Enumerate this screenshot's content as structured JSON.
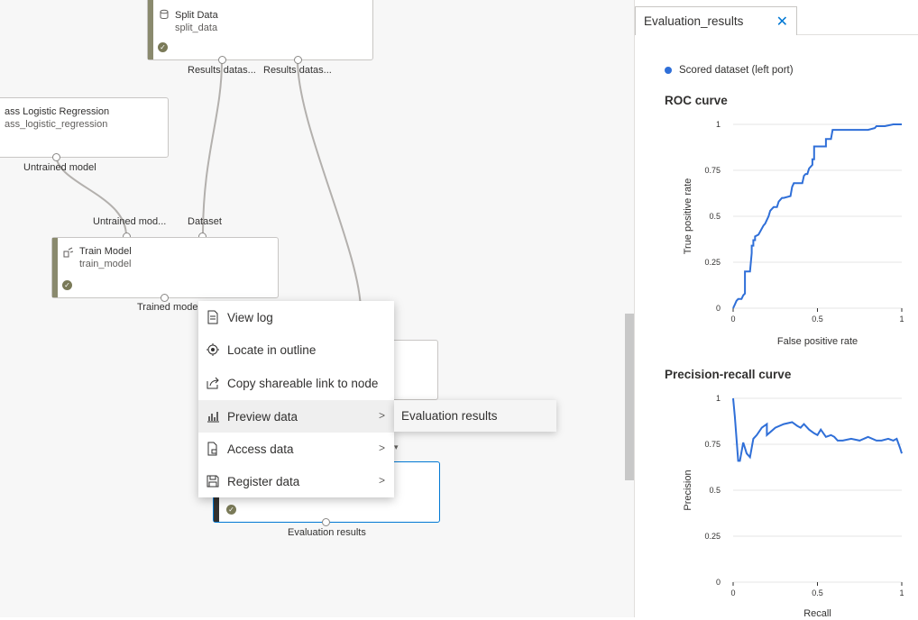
{
  "canvas": {
    "split_node": {
      "title": "Split Data",
      "subtitle": "split_data",
      "port1": "Results datas...",
      "port2": "Results datas..."
    },
    "logreg_node": {
      "title": "ass Logistic Regression",
      "subtitle": "ass_logistic_regression",
      "port": "Untrained model"
    },
    "train_node": {
      "title": "Train Model",
      "subtitle": "train_model",
      "in1": "Untrained mod...",
      "in2": "Dataset",
      "out": "Trained model"
    },
    "eval_node": {
      "out": "Evaluation results"
    }
  },
  "context_menu": {
    "items": [
      {
        "label": "View log",
        "icon": "document-icon"
      },
      {
        "label": "Locate in outline",
        "icon": "locate-icon"
      },
      {
        "label": "Copy shareable link to node",
        "icon": "share-icon"
      },
      {
        "label": "Preview data",
        "icon": "chart-icon",
        "has_submenu": true
      },
      {
        "label": "Access data",
        "icon": "file-lock-icon",
        "has_submenu": true
      },
      {
        "label": "Register data",
        "icon": "save-icon",
        "has_submenu": true
      }
    ],
    "submenu": {
      "label": "Evaluation results"
    }
  },
  "panel": {
    "tab_title": "Evaluation_results",
    "legend": "Scored dataset (left port)",
    "roc_title": "ROC curve",
    "pr_title": "Precision-recall curve"
  },
  "colors": {
    "series": "#2f6fd8",
    "accent": "#0078d4",
    "node_stripe": "#8a8a6e"
  },
  "chart_data": [
    {
      "type": "line",
      "title": "ROC curve",
      "xlabel": "False positive rate",
      "ylabel": "True positive rate",
      "xlim": [
        0,
        1
      ],
      "ylim": [
        0,
        1
      ],
      "xticks": [
        "0",
        "0.5",
        "1"
      ],
      "yticks": [
        "0",
        "0.25",
        "0.5",
        "0.75",
        "1"
      ],
      "grid": true,
      "series": [
        {
          "name": "Scored dataset (left port)",
          "x": [
            0,
            0.01,
            0.02,
            0.03,
            0.05,
            0.06,
            0.07,
            0.07,
            0.1,
            0.11,
            0.11,
            0.12,
            0.12,
            0.13,
            0.13,
            0.15,
            0.15,
            0.18,
            0.19,
            0.2,
            0.21,
            0.22,
            0.23,
            0.24,
            0.26,
            0.27,
            0.28,
            0.29,
            0.3,
            0.34,
            0.35,
            0.36,
            0.37,
            0.41,
            0.42,
            0.43,
            0.44,
            0.45,
            0.47,
            0.47,
            0.48,
            0.48,
            0.55,
            0.55,
            0.58,
            0.59,
            0.61,
            0.65,
            0.7,
            0.75,
            0.8,
            0.84,
            0.85,
            0.9,
            0.95,
            1.0
          ],
          "y": [
            0,
            0.02,
            0.04,
            0.05,
            0.05,
            0.07,
            0.08,
            0.2,
            0.2,
            0.3,
            0.34,
            0.34,
            0.37,
            0.37,
            0.39,
            0.4,
            0.4,
            0.45,
            0.46,
            0.48,
            0.5,
            0.53,
            0.54,
            0.55,
            0.55,
            0.58,
            0.59,
            0.6,
            0.6,
            0.61,
            0.66,
            0.68,
            0.68,
            0.68,
            0.72,
            0.73,
            0.73,
            0.76,
            0.78,
            0.81,
            0.81,
            0.88,
            0.88,
            0.92,
            0.92,
            0.97,
            0.97,
            0.97,
            0.97,
            0.97,
            0.97,
            0.98,
            0.99,
            0.99,
            1.0,
            1.0
          ]
        }
      ]
    },
    {
      "type": "line",
      "title": "Precision-recall curve",
      "xlabel": "Recall",
      "ylabel": "Precision",
      "xlim": [
        0,
        1
      ],
      "ylim": [
        0,
        1
      ],
      "xticks": [
        "0",
        "0.5",
        "1"
      ],
      "yticks": [
        "0",
        "0.25",
        "0.5",
        "0.75",
        "1"
      ],
      "grid": true,
      "series": [
        {
          "name": "Scored dataset (left port)",
          "x": [
            0,
            0.01,
            0.03,
            0.04,
            0.06,
            0.08,
            0.1,
            0.12,
            0.14,
            0.17,
            0.2,
            0.2,
            0.25,
            0.3,
            0.35,
            0.38,
            0.4,
            0.42,
            0.45,
            0.48,
            0.5,
            0.52,
            0.55,
            0.58,
            0.6,
            0.62,
            0.65,
            0.7,
            0.75,
            0.8,
            0.85,
            0.88,
            0.92,
            0.95,
            0.97,
            0.99,
            1.0
          ],
          "y": [
            1.0,
            0.9,
            0.66,
            0.66,
            0.76,
            0.7,
            0.68,
            0.78,
            0.8,
            0.84,
            0.86,
            0.8,
            0.84,
            0.86,
            0.87,
            0.85,
            0.84,
            0.86,
            0.83,
            0.81,
            0.8,
            0.83,
            0.79,
            0.8,
            0.79,
            0.77,
            0.77,
            0.78,
            0.77,
            0.79,
            0.77,
            0.77,
            0.78,
            0.77,
            0.78,
            0.73,
            0.7
          ]
        }
      ]
    }
  ]
}
